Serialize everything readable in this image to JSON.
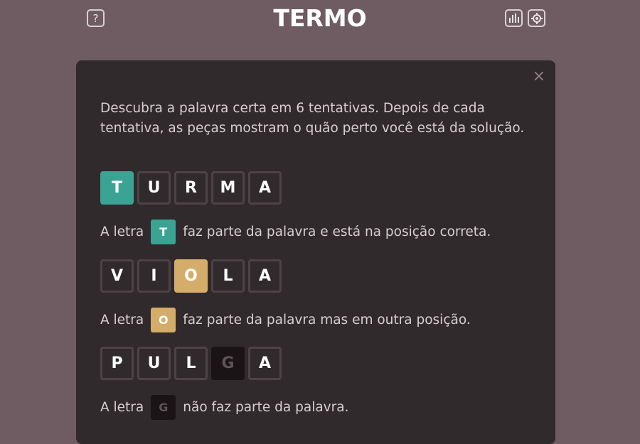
{
  "header": {
    "title": "TERMO",
    "help_icon": "?",
    "stats_icon": "bar-chart-icon",
    "settings_icon": "gear-icon"
  },
  "modal": {
    "close": "×",
    "intro": "Descubra a palavra certa em 6 tentativas. Depois de cada tentativa, as peças mostram o quão perto você está da solução.",
    "examples": [
      {
        "letters": [
          "T",
          "U",
          "R",
          "M",
          "A"
        ],
        "pre": "A letra",
        "letter": "T",
        "post": "faz parte da palavra e está na posição correta."
      },
      {
        "letters": [
          "V",
          "I",
          "O",
          "L",
          "A"
        ],
        "pre": "A letra",
        "letter": "O",
        "post": "faz parte da palavra mas em outra posição."
      },
      {
        "letters": [
          "P",
          "U",
          "L",
          "G",
          "A"
        ],
        "pre": "A letra",
        "letter": "G",
        "post": "não faz parte da palavra."
      }
    ]
  },
  "colors": {
    "background": "#6e5c62",
    "modal": "#312a2c",
    "correct": "#3aa394",
    "present": "#d3ad69",
    "absent": "#1a1416"
  }
}
